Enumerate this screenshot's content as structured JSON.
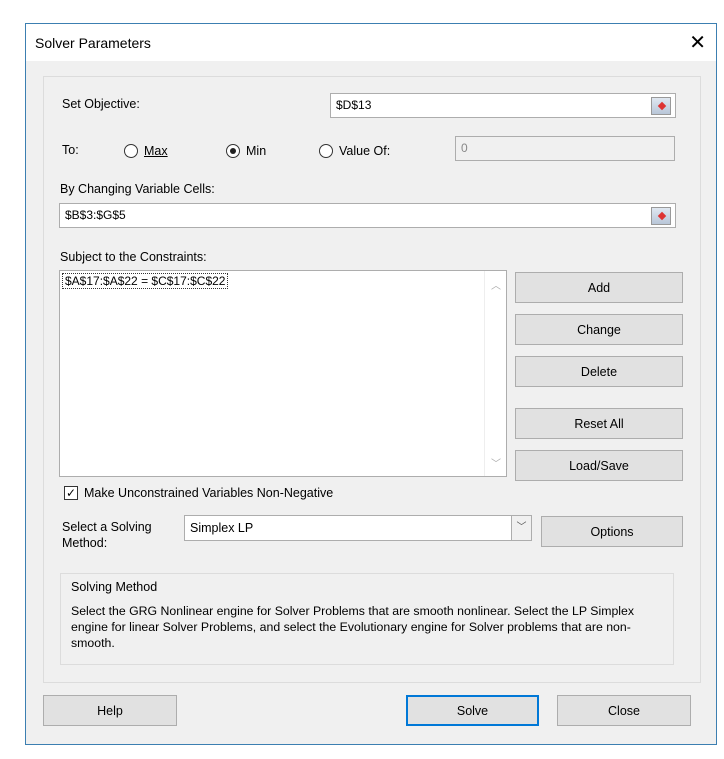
{
  "window": {
    "title": "Solver Parameters",
    "close": "✕"
  },
  "objective": {
    "label": "Set Objective:",
    "value": "$D$13"
  },
  "to": {
    "label": "To:",
    "max": "Max",
    "min": "Min",
    "value_of": "Value Of:",
    "value_input": "0",
    "selected": "Min"
  },
  "changing": {
    "label": "By Changing Variable Cells:",
    "value": "$B$3:$G$5"
  },
  "constraints": {
    "label": "Subject to the Constraints:",
    "items": [
      "$A$17:$A$22 = $C$17:$C$22"
    ]
  },
  "buttons": {
    "add": "Add",
    "change": "Change",
    "delete": "Delete",
    "reset": "Reset All",
    "loadsave": "Load/Save",
    "options": "Options",
    "help": "Help",
    "solve": "Solve",
    "close": "Close"
  },
  "nonneg": {
    "label": "Make Unconstrained Variables Non-Negative",
    "checked": true
  },
  "method": {
    "label1": "Select a Solving",
    "label2": "Method:",
    "value": "Simplex LP"
  },
  "info": {
    "title": "Solving Method",
    "text": "Select the GRG Nonlinear engine for Solver Problems that are smooth nonlinear. Select the LP Simplex engine for linear Solver Problems, and select the Evolutionary engine for Solver problems that are non-smooth."
  }
}
